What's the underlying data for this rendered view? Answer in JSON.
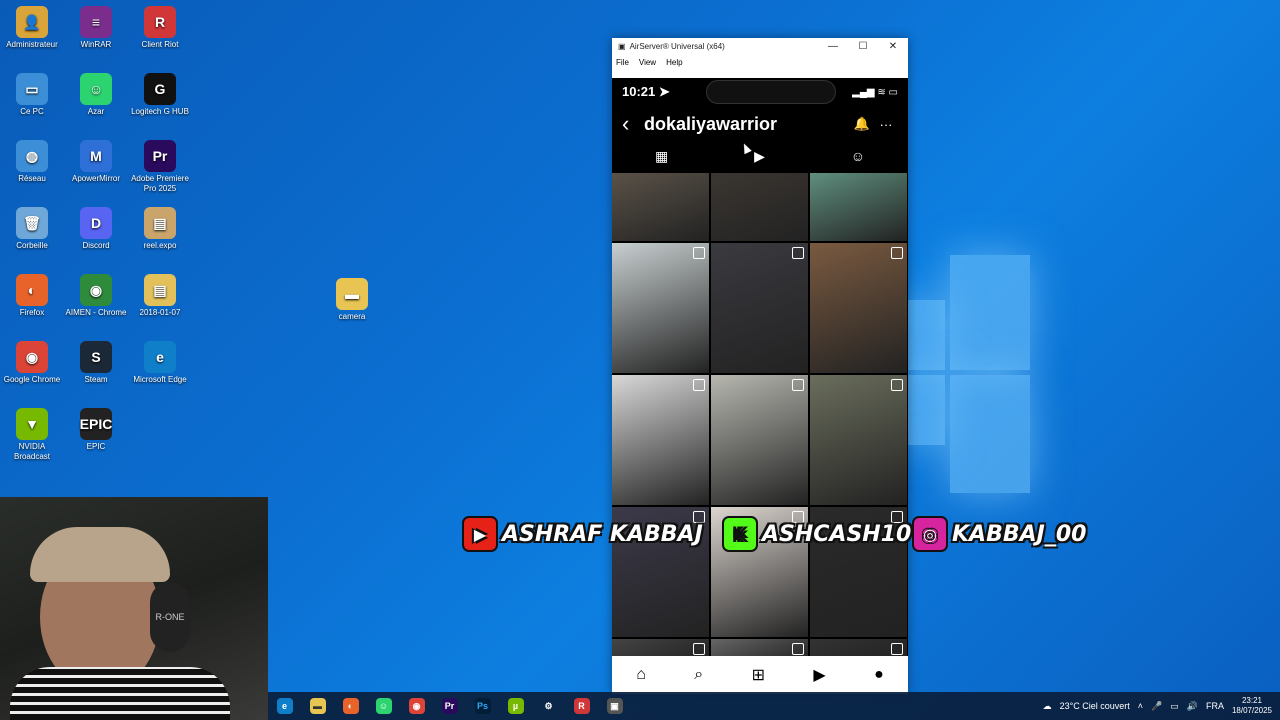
{
  "desktop": {
    "icons": [
      {
        "label": "Administrateur",
        "color": "#d9a53a",
        "glyph": "👤"
      },
      {
        "label": "WinRAR",
        "color": "#7b2d8e",
        "glyph": "≡"
      },
      {
        "label": "Client Riot",
        "color": "#d13639",
        "glyph": "R"
      },
      {
        "label": "Ce PC",
        "color": "#3c8fd6",
        "glyph": "▭"
      },
      {
        "label": "Azar",
        "color": "#2bd46f",
        "glyph": "☺"
      },
      {
        "label": "Logitech G HUB",
        "color": "#111111",
        "glyph": "G"
      },
      {
        "label": "Réseau",
        "color": "#3c8fd6",
        "glyph": "◍"
      },
      {
        "label": "ApowerMirror",
        "color": "#2e6fd8",
        "glyph": "M"
      },
      {
        "label": "Adobe Premiere Pro 2025",
        "color": "#2a0a5c",
        "glyph": "Pr"
      },
      {
        "label": "Corbeille",
        "color": "#6fa8d8",
        "glyph": "🗑"
      },
      {
        "label": "Discord",
        "color": "#5865f2",
        "glyph": "D"
      },
      {
        "label": "reel.expo",
        "color": "#c9a46b",
        "glyph": "▤"
      },
      {
        "label": "Firefox",
        "color": "#e8632a",
        "glyph": "◐"
      },
      {
        "label": "AIMEN - Chrome",
        "color": "#2e8b3c",
        "glyph": "◉"
      },
      {
        "label": "2018-01-07",
        "color": "#e2c15a",
        "glyph": "▤"
      },
      {
        "label": "Google Chrome",
        "color": "#db4437",
        "glyph": "◉"
      },
      {
        "label": "Steam",
        "color": "#1b2838",
        "glyph": "S"
      },
      {
        "label": "Microsoft Edge",
        "color": "#0f7fc9",
        "glyph": "e"
      },
      {
        "label": "NVIDIA Broadcast",
        "color": "#76b900",
        "glyph": "▼"
      },
      {
        "label": "EPIC",
        "color": "#222222",
        "glyph": "EPIC"
      }
    ],
    "camera_folder": "camera"
  },
  "airserver": {
    "title": "AirServer® Universal (x64)",
    "menu": [
      "File",
      "View",
      "Help"
    ]
  },
  "phone": {
    "time": "10:21",
    "status_icons": "▂▄▆ ≋ ▭",
    "username": "dokaliyawarrior",
    "tabs": [
      "grid",
      "reels",
      "tagged"
    ]
  },
  "social": {
    "youtube": "ASHRAF KABBAJ",
    "kick": "ASHCASH10",
    "instagram": "KABBAJ_00"
  },
  "webcam": {
    "headset_label": "R-ONE"
  },
  "taskbar": {
    "weather": "23°C Ciel couvert",
    "lang": "FRA",
    "time": "23:21",
    "date": "18/07/2025"
  },
  "colors": {
    "youtube": "#e62117",
    "kick": "#53fc18",
    "instagram": "#d6249f"
  }
}
